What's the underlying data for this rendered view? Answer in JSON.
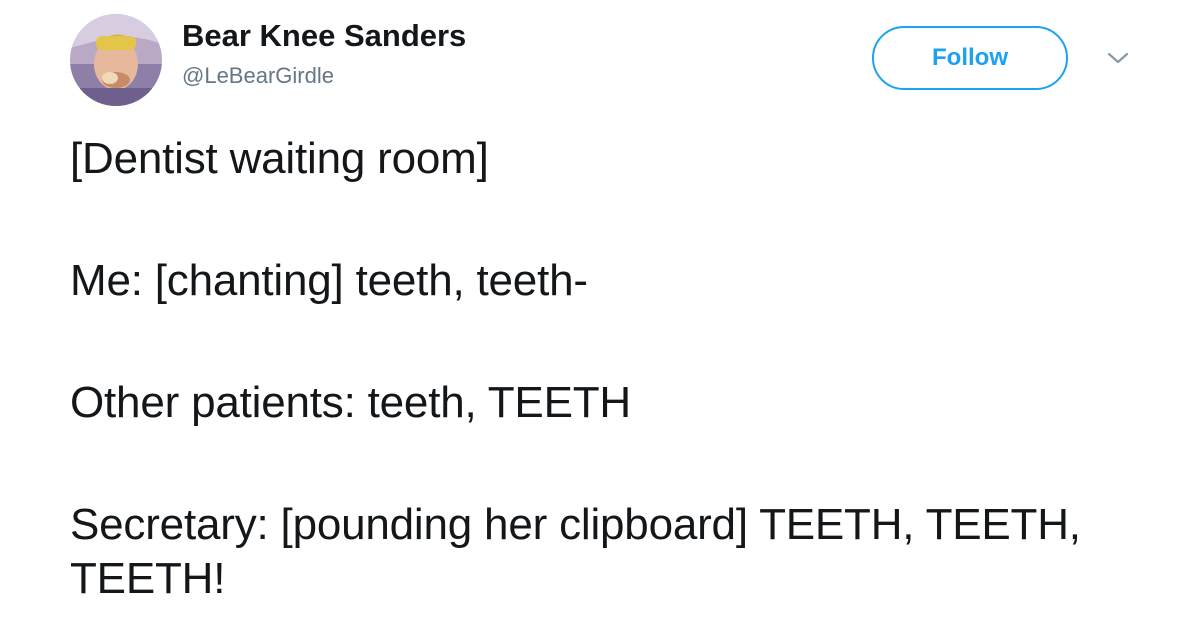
{
  "user": {
    "display_name": "Bear Knee Sanders",
    "handle": "@LeBearGirdle"
  },
  "actions": {
    "follow_label": "Follow",
    "caret_icon": "chevron-down-icon"
  },
  "tweet": {
    "paragraphs": [
      "[Dentist waiting room]",
      "Me: [chanting] teeth, teeth-",
      "Other patients: teeth, TEETH",
      "Secretary: [pounding her clipboard] TEETH, TEETH, TEETH!"
    ]
  },
  "colors": {
    "accent": "#1da1f2",
    "text": "#14171a",
    "muted": "#657786"
  }
}
